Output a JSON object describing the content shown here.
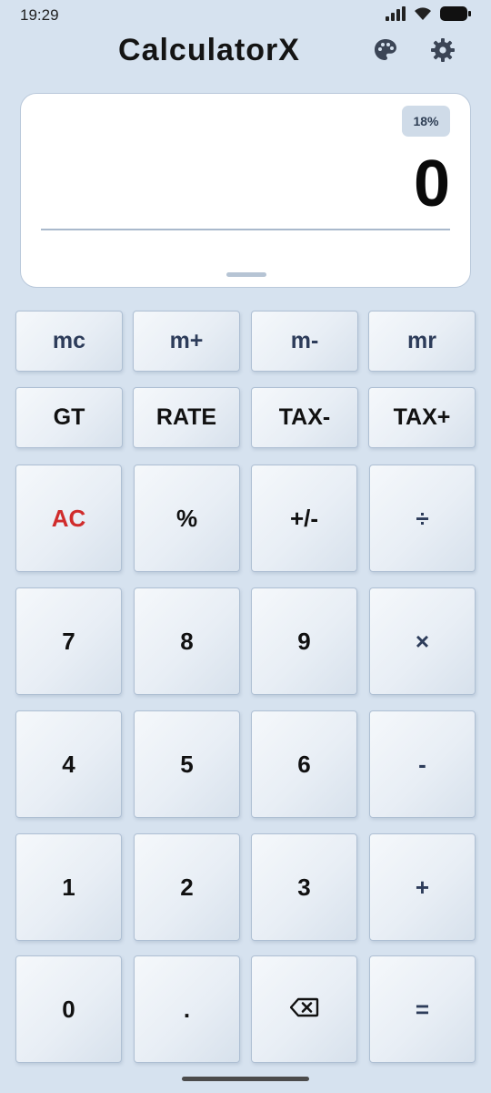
{
  "status_bar": {
    "time": "19:29",
    "icons": [
      "signal-icon",
      "wifi-icon",
      "battery-icon"
    ]
  },
  "header": {
    "title": "CalculatorX",
    "icons": [
      "palette-icon",
      "settings-gear-icon"
    ]
  },
  "display": {
    "tax_rate_badge": "18%",
    "value": "0"
  },
  "keys": {
    "mc": "mc",
    "m_plus": "m+",
    "m_minus": "m-",
    "mr": "mr",
    "gt": "GT",
    "rate": "RATE",
    "tax_minus": "TAX-",
    "tax_plus": "TAX+",
    "ac": "AC",
    "percent": "%",
    "plus_minus": "+/-",
    "divide": "÷",
    "seven": "7",
    "eight": "8",
    "nine": "9",
    "multiply": "×",
    "four": "4",
    "five": "5",
    "six": "6",
    "minus": "-",
    "one": "1",
    "two": "2",
    "three": "3",
    "plus": "+",
    "zero": "0",
    "decimal": ".",
    "backspace_icon": "backspace-icon",
    "equals": "="
  },
  "colors": {
    "background": "#d6e2ef",
    "ac_red": "#d02c2c",
    "operator_navy": "#2d3c5a"
  }
}
